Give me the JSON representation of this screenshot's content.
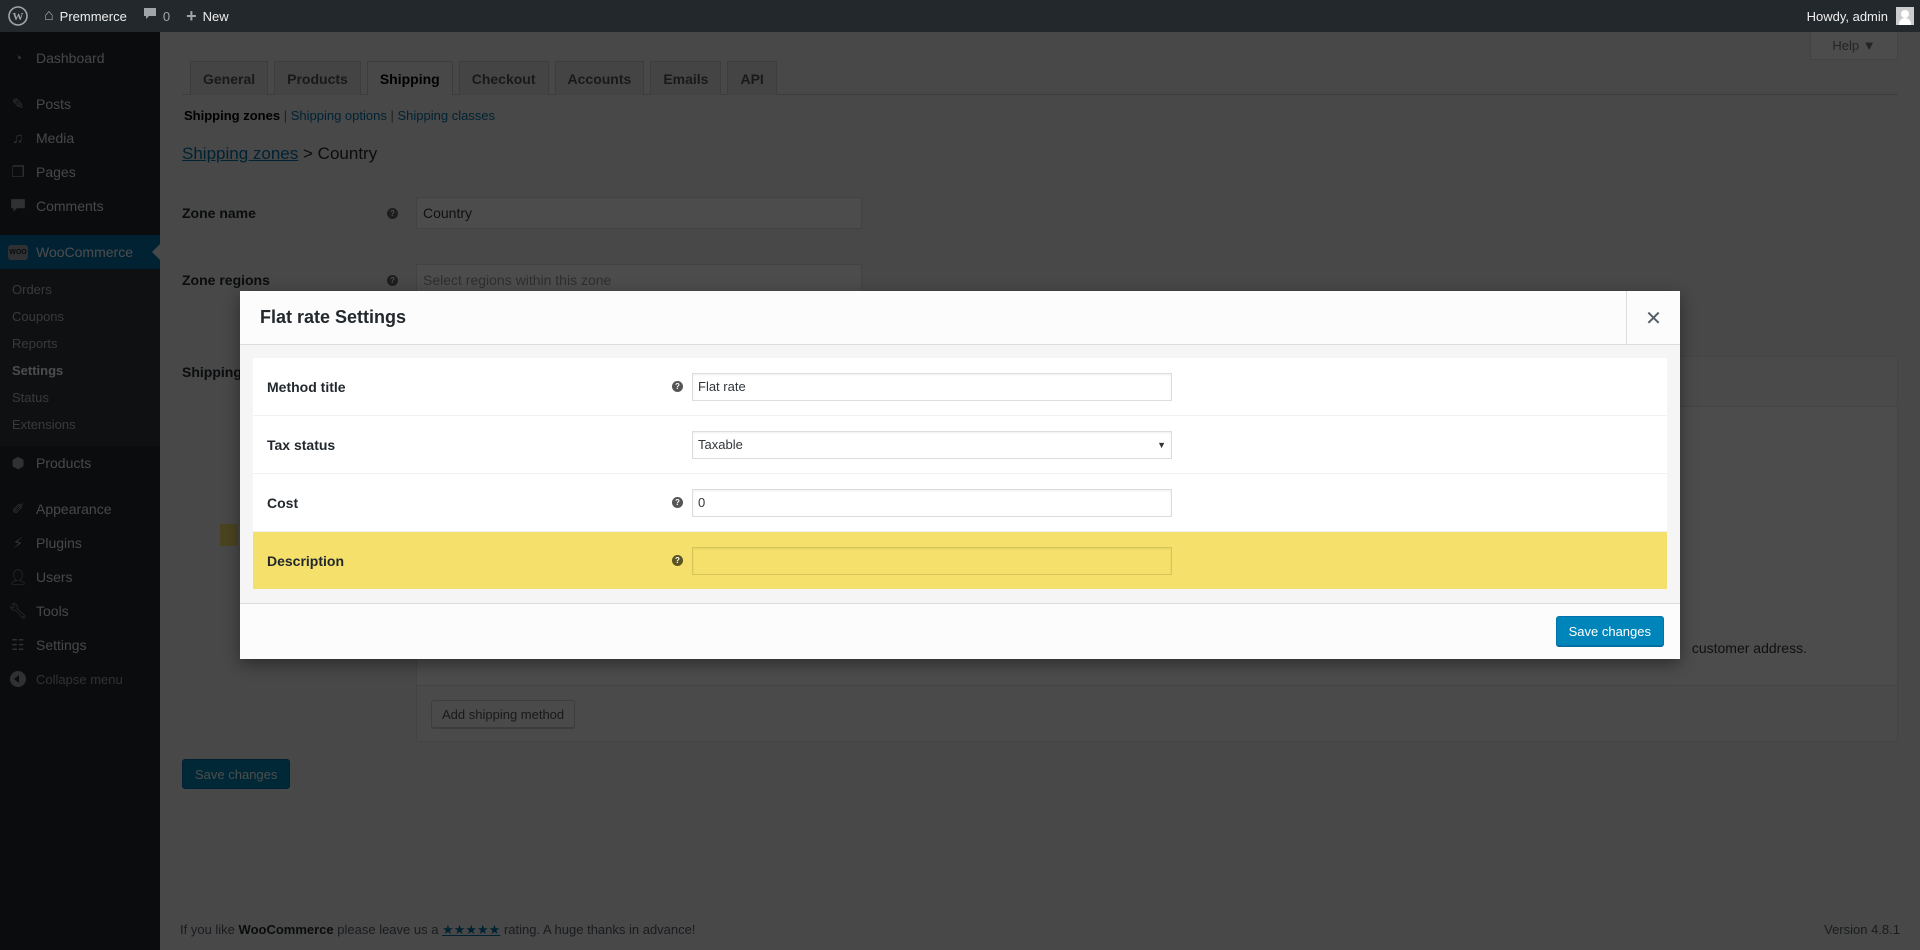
{
  "adminbar": {
    "site_name": "Premmerce",
    "comments_count": "0",
    "new_label": "New",
    "howdy": "Howdy, admin"
  },
  "sidebar": {
    "items": [
      {
        "label": "Dashboard",
        "icon": "dashboard-icon"
      },
      {
        "label": "Posts",
        "icon": "pin-icon"
      },
      {
        "label": "Media",
        "icon": "media-icon"
      },
      {
        "label": "Pages",
        "icon": "pages-icon"
      },
      {
        "label": "Comments",
        "icon": "comment-icon"
      },
      {
        "label": "WooCommerce",
        "icon": "woocommerce-icon"
      },
      {
        "label": "Products",
        "icon": "box-icon"
      },
      {
        "label": "Appearance",
        "icon": "brush-icon"
      },
      {
        "label": "Plugins",
        "icon": "plug-icon"
      },
      {
        "label": "Users",
        "icon": "user-icon"
      },
      {
        "label": "Tools",
        "icon": "wrench-icon"
      },
      {
        "label": "Settings",
        "icon": "sliders-icon"
      },
      {
        "label": "Collapse menu",
        "icon": "collapse-icon"
      }
    ],
    "woo_badge": "WOO",
    "submenu": [
      "Orders",
      "Coupons",
      "Reports",
      "Settings",
      "Status",
      "Extensions"
    ],
    "current_submenu": "Settings"
  },
  "page": {
    "help_label": "Help ▼",
    "tabs": [
      "General",
      "Products",
      "Shipping",
      "Checkout",
      "Accounts",
      "Emails",
      "API"
    ],
    "active_tab": "Shipping",
    "subnav": {
      "current": "Shipping zones",
      "link1": "Shipping options",
      "link2": "Shipping classes",
      "sep": "|"
    },
    "breadcrumb": {
      "link": "Shipping zones",
      "sep": ">",
      "current": "Country"
    },
    "zone_name_label": "Zone name",
    "zone_name_value": "Country",
    "zone_regions_label": "Zone regions",
    "zone_regions_placeholder": "Select regions within this zone",
    "shipping_methods_label": "Shipping methods",
    "methods_note": "customer address.",
    "add_method_label": "Add shipping method",
    "save_label": "Save changes"
  },
  "footer": {
    "prefix": "If you like ",
    "brand": "WooCommerce",
    "middle": " please leave us a ",
    "stars": "★★★★★",
    "suffix": " rating. A huge thanks in advance!",
    "version": "Version 4.8.1"
  },
  "modal": {
    "title": "Flat rate Settings",
    "close_glyph": "✕",
    "help_glyph": "?",
    "fields": [
      {
        "label": "Method title",
        "value": "Flat rate",
        "has_help": true,
        "type": "text"
      },
      {
        "label": "Tax status",
        "value": "Taxable",
        "has_help": false,
        "type": "select"
      },
      {
        "label": "Cost",
        "value": "0",
        "has_help": true,
        "type": "text"
      },
      {
        "label": "Description",
        "value": "",
        "has_help": true,
        "type": "text",
        "highlighted": true
      }
    ],
    "select_arrow": "▼",
    "save_label": "Save changes",
    "highlight_color": "#f4e06b",
    "primary_color": "#0085ba"
  }
}
